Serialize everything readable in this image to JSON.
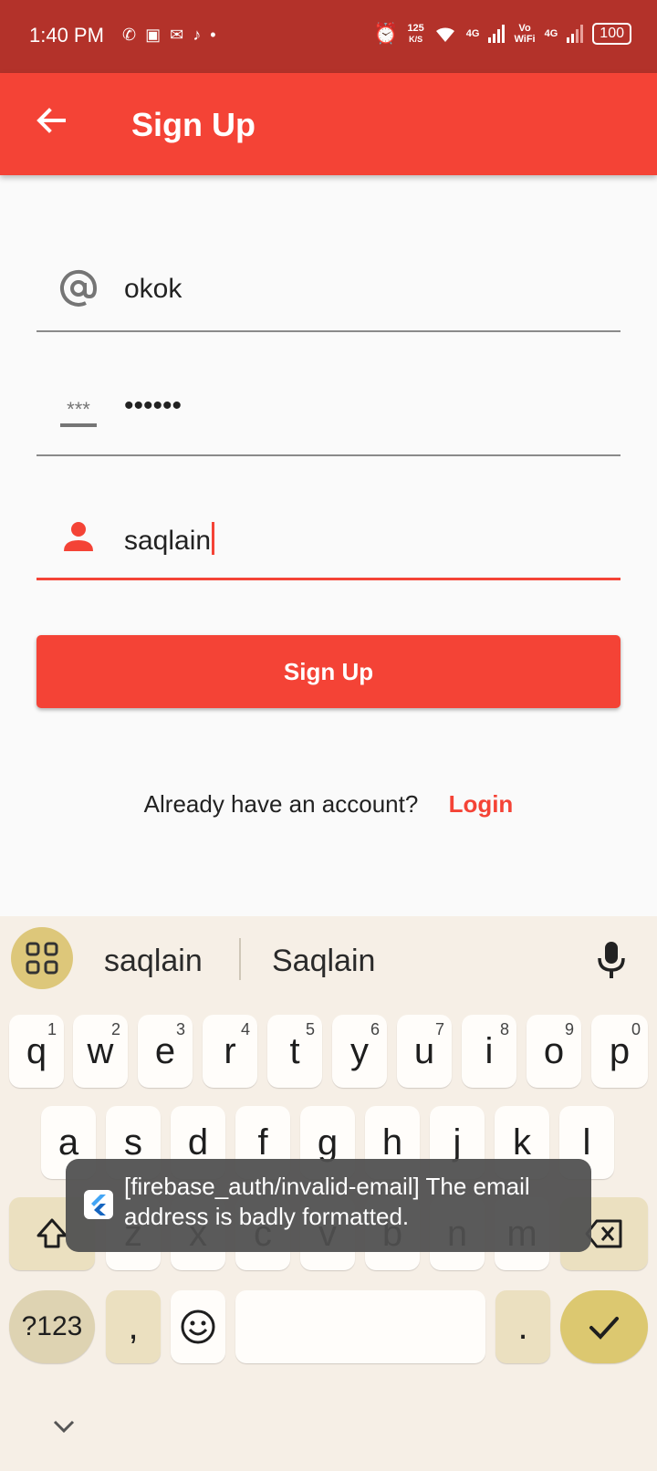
{
  "status_bar": {
    "time": "1:40 PM",
    "net_speed_value": "125",
    "net_speed_unit": "K/S",
    "signal1_label": "4G",
    "volte_label_top": "Vo",
    "volte_label_bottom": "WiFi",
    "signal2_label": "4G",
    "battery": "100"
  },
  "app_bar": {
    "title": "Sign Up"
  },
  "form": {
    "email_value": "okok",
    "password_value": "••••••",
    "name_value": "saqlain",
    "submit_label": "Sign Up"
  },
  "login_prompt": {
    "question": "Already have an account?",
    "link": "Login"
  },
  "keyboard": {
    "suggestions": [
      "saqlain",
      "Saqlain"
    ],
    "row1": [
      {
        "key": "q",
        "hint": "1"
      },
      {
        "key": "w",
        "hint": "2"
      },
      {
        "key": "e",
        "hint": "3"
      },
      {
        "key": "r",
        "hint": "4"
      },
      {
        "key": "t",
        "hint": "5"
      },
      {
        "key": "y",
        "hint": "6"
      },
      {
        "key": "u",
        "hint": "7"
      },
      {
        "key": "i",
        "hint": "8"
      },
      {
        "key": "o",
        "hint": "9"
      },
      {
        "key": "p",
        "hint": "0"
      }
    ],
    "row2": [
      "a",
      "s",
      "d",
      "f",
      "g",
      "h",
      "j",
      "k",
      "l"
    ],
    "row3": [
      "z",
      "x",
      "c",
      "v",
      "b",
      "n",
      "m"
    ],
    "symbols_label": "?123",
    "comma": ",",
    "period": "."
  },
  "toast": {
    "message": "[firebase_auth/invalid-email] The email address is badly formatted."
  },
  "colors": {
    "status_bar": "#b3322a",
    "accent": "#f44336",
    "keyboard_bg": "#f6efe6"
  }
}
